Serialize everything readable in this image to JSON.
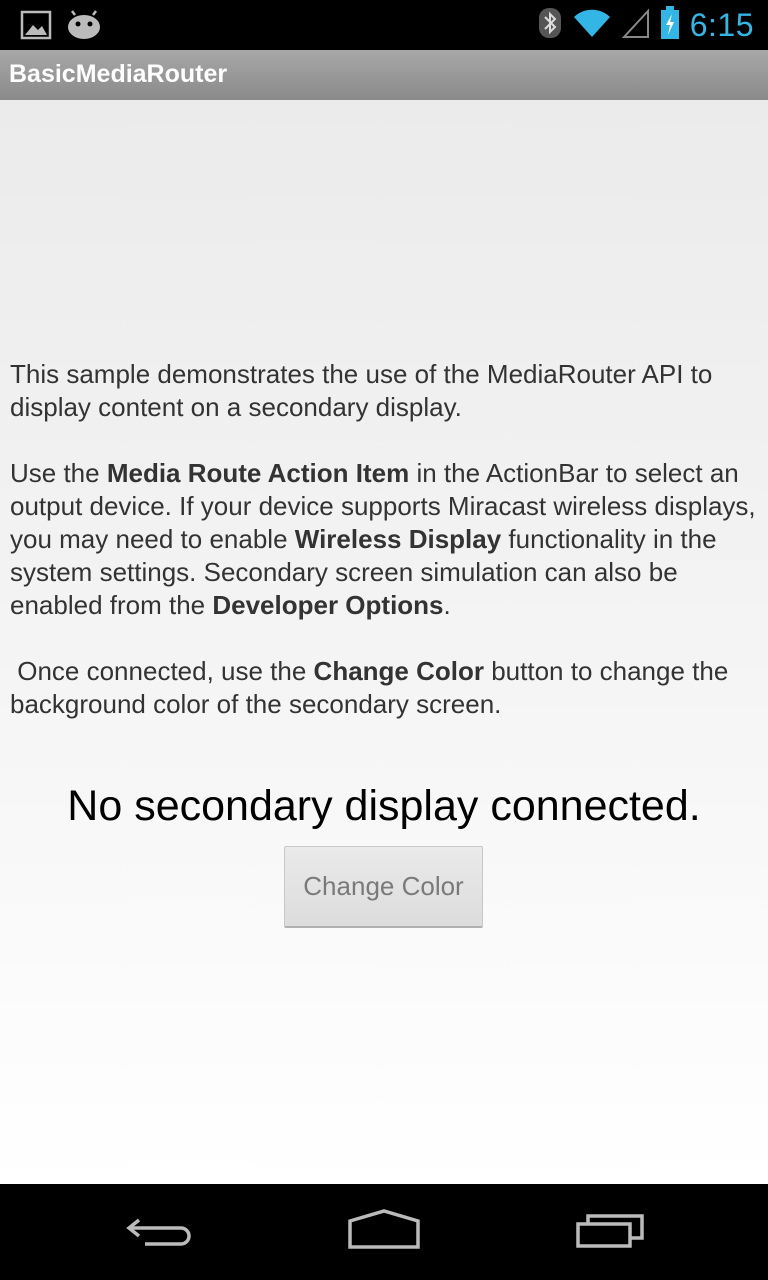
{
  "status_bar": {
    "time": "6:15",
    "left_icons": [
      "image-icon",
      "android-icon"
    ],
    "right_icons": [
      "bluetooth-icon",
      "wifi-icon",
      "signal-icon",
      "battery-charging-icon"
    ]
  },
  "action_bar": {
    "title": "BasicMediaRouter"
  },
  "main": {
    "intro_1": "This sample demonstrates the use of the MediaRouter API to display content on a secondary display.",
    "p2_a": "Use the ",
    "p2_b": "Media Route Action Item",
    "p2_c": " in the ActionBar to select an output device. If your device supports Miracast wireless displays, you may need to enable ",
    "p2_d": "Wireless Display",
    "p2_e": " functionality in the system settings. Secondary screen simulation can also be enabled from the ",
    "p2_f": "Developer Options",
    "p2_g": ".",
    "p3_a": " Once connected, use the ",
    "p3_b": "Change Color",
    "p3_c": " button to change the background color of the secondary screen.",
    "status_message": "No secondary display connected.",
    "change_color_label": "Change Color"
  },
  "nav_bar": {
    "icons": [
      "back-icon",
      "home-icon",
      "recents-icon"
    ]
  },
  "colors": {
    "clock": "#33b5e5",
    "action_bar": "#999999",
    "background": "#f0f0f0"
  }
}
